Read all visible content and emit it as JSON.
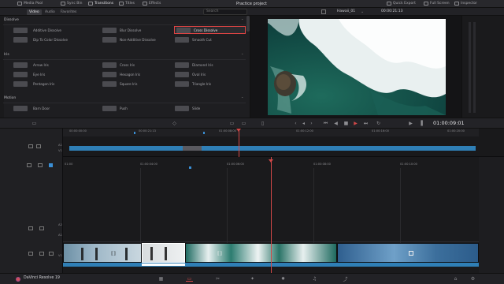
{
  "topbar": {
    "media_pool": "Media Pool",
    "sync_bin": "Sync Bin",
    "transitions": "Transitions",
    "titles": "Titles",
    "effects": "Effects",
    "project_title": "Practice project",
    "quick_export": "Quick Export",
    "full_screen": "Full Screen",
    "inspector": "Inspector"
  },
  "subbar": {
    "tab_video": "Video",
    "tab_audio": "Audio",
    "tab_favorites": "Favorites",
    "search_placeholder": "Search",
    "timeline_name": "Hawaii_01",
    "timecode": "00:00:21:13"
  },
  "effects": {
    "dissolve": {
      "header": "Dissolve",
      "items": [
        "Additive Dissolve",
        "Blur Dissolve",
        "Cross Dissolve",
        "Dip To Color Dissolve",
        "Non-Additive Dissolve",
        "Smooth Cut"
      ]
    },
    "iris": {
      "header": "Iris",
      "items": [
        "Arrow Iris",
        "Cross Iris",
        "Diamond Iris",
        "Eye Iris",
        "Hexagon Iris",
        "Oval Iris",
        "Pentagon Iris",
        "Square Iris",
        "Triangle Iris"
      ]
    },
    "motion": {
      "header": "Motion",
      "items": [
        "Barn Door",
        "Push",
        "Slide"
      ]
    }
  },
  "viewer": {
    "timecode": "01:00:09:01"
  },
  "upper_timeline": {
    "track_a1": "A1",
    "track_v1": "V1",
    "ruler": [
      "00:00:00:00",
      "00:00:21:13",
      "01:00:08:00",
      "01:00:12:00",
      "01:00:16:00",
      "01:00:20:00"
    ]
  },
  "lower_timeline": {
    "ruler": [
      "01:00",
      "01:00:04:00",
      "01:00:06:00",
      "01:00:08:00",
      "01:00:10:00",
      "01:00:12:00"
    ],
    "tracks": [
      "A2",
      "A1",
      "V1"
    ]
  },
  "bottombar": {
    "app_name": "DaVinci Resolve 19"
  },
  "colors": {
    "accent_red": "#d24848",
    "clip_blue": "#2f7fb6",
    "selected_outline": "#dd4444"
  }
}
